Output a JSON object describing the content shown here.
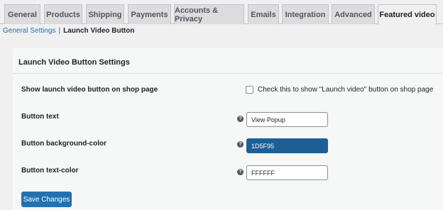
{
  "tabs": [
    "General",
    "Products",
    "Shipping",
    "Payments",
    "Accounts & Privacy",
    "Emails",
    "Integration",
    "Advanced",
    "Featured video"
  ],
  "active_tab": "Featured video",
  "breadcrumb": {
    "general_settings": "General Settings",
    "separator": "|",
    "current": "Launch Video Button"
  },
  "section_title": "Launch Video Button Settings",
  "fields": {
    "show_button": {
      "label": "Show launch video button on shop page",
      "checkbox_label": "Check this to show \"Launch video\" button on shop page",
      "checked": false
    },
    "button_text": {
      "label": "Button text",
      "value": "View Popup"
    },
    "bg_color": {
      "label": "Button background-color",
      "value": "1D5F95",
      "swatch": "#1d5f95"
    },
    "text_color": {
      "label": "Button text-color",
      "value": "FFFFFF"
    }
  },
  "help_icon": "?",
  "save_label": "Save Changes",
  "colors": {
    "accent": "#2271b1",
    "page_bg": "#f0f0f1"
  }
}
